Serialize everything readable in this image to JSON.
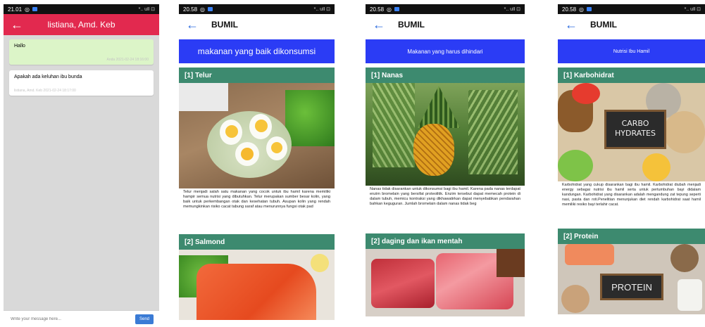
{
  "screen1": {
    "status_time": "21.01",
    "status_right": "*.. ull ⊡",
    "header_title": "listiana, Amd. Keb",
    "messages": [
      {
        "text": "Hallo",
        "meta": "Anda 2021-02-24 18:16:00"
      },
      {
        "text": "Apakah ada keluhan ibu bunda",
        "meta": "listiana, Amd. Keb 2021-02-24 18:17:00"
      }
    ],
    "input_placeholder": "Write your message here...",
    "send_label": "Send"
  },
  "screen2": {
    "status_time": "20.58",
    "status_right": "*.. ull ⊡",
    "header_title": "BUMIL",
    "banner": "makanan yang baik dikonsumsi",
    "section1": "[1] Telur",
    "body": "Telur menjadi salah satu makanan yang cocok untuk ibu hamil karena memiliki hampir semua nutrisi yang dibutuhkan. Telur merupakan sumber besar kolin, yang baik untuk perkembangan otak dan kesehatan tubuh. Asupan kolin yang rendah memungkinkan risiko cacat tabung saraf atau menurunnya fungsi otak pad",
    "section2": "[2] Salmond"
  },
  "screen3": {
    "status_time": "20.58",
    "status_right": "*.. ull ⊡",
    "header_title": "BUMIL",
    "banner": "Makanan yang harus dihindari",
    "section1": "[1] Nanas",
    "body": "Nanas tidak disarankan untuk dikonsumsi bagi ibu hamil. Karena pada nanas terdapat enzim bromelain yang bersifat proteolitik. Enzim tersebut dapat memecah protein di dalam tubuh, memicu kontraksi yang dikhawatirkan dapat menyebabkan pendarahan bahkan keguguran. Jumlah bromelain dalam nanas tidak beg",
    "section2": "[2] daging dan ikan mentah"
  },
  "screen4": {
    "status_time": "20.58",
    "status_right": "*.. ull ⊡",
    "header_title": "BUMIL",
    "banner": "Nutrisi Ibu Hamil",
    "section1": "[1] Karbohidrat",
    "carbo_sign_line1": "CARBO",
    "carbo_sign_line2": "HYDRATES",
    "body": "Karbohidrat yang cukup disarankan bagi ibu hamil. Karbohidrat diubah menjadi energy sebagai nutrisi ibu hamil serta untuk pertumbuhan bayi didalam kandungan. Karbohidrat yang disarankan adalah mengandung zat tepung seperti nasi, pasta dan roti.Penelitian menunjukan diet rendah karbohidrat saat hamil memiliki resiko bayi terlahir cacat.",
    "section2": "[2] Protein",
    "protein_sign": "PROTEIN"
  },
  "colors": {
    "chat_header": "#e2294f",
    "chat_bg": "#d9d9d9",
    "my_bubble": "#dcf5c8",
    "banner_blue": "#2b3cf5",
    "section_green": "#3d8a6f",
    "back_arrow_blue": "#2d6cdf"
  },
  "icons": [
    "back-arrow-icon",
    "whatsapp-status-icon",
    "signal-icon",
    "battery-icon"
  ]
}
